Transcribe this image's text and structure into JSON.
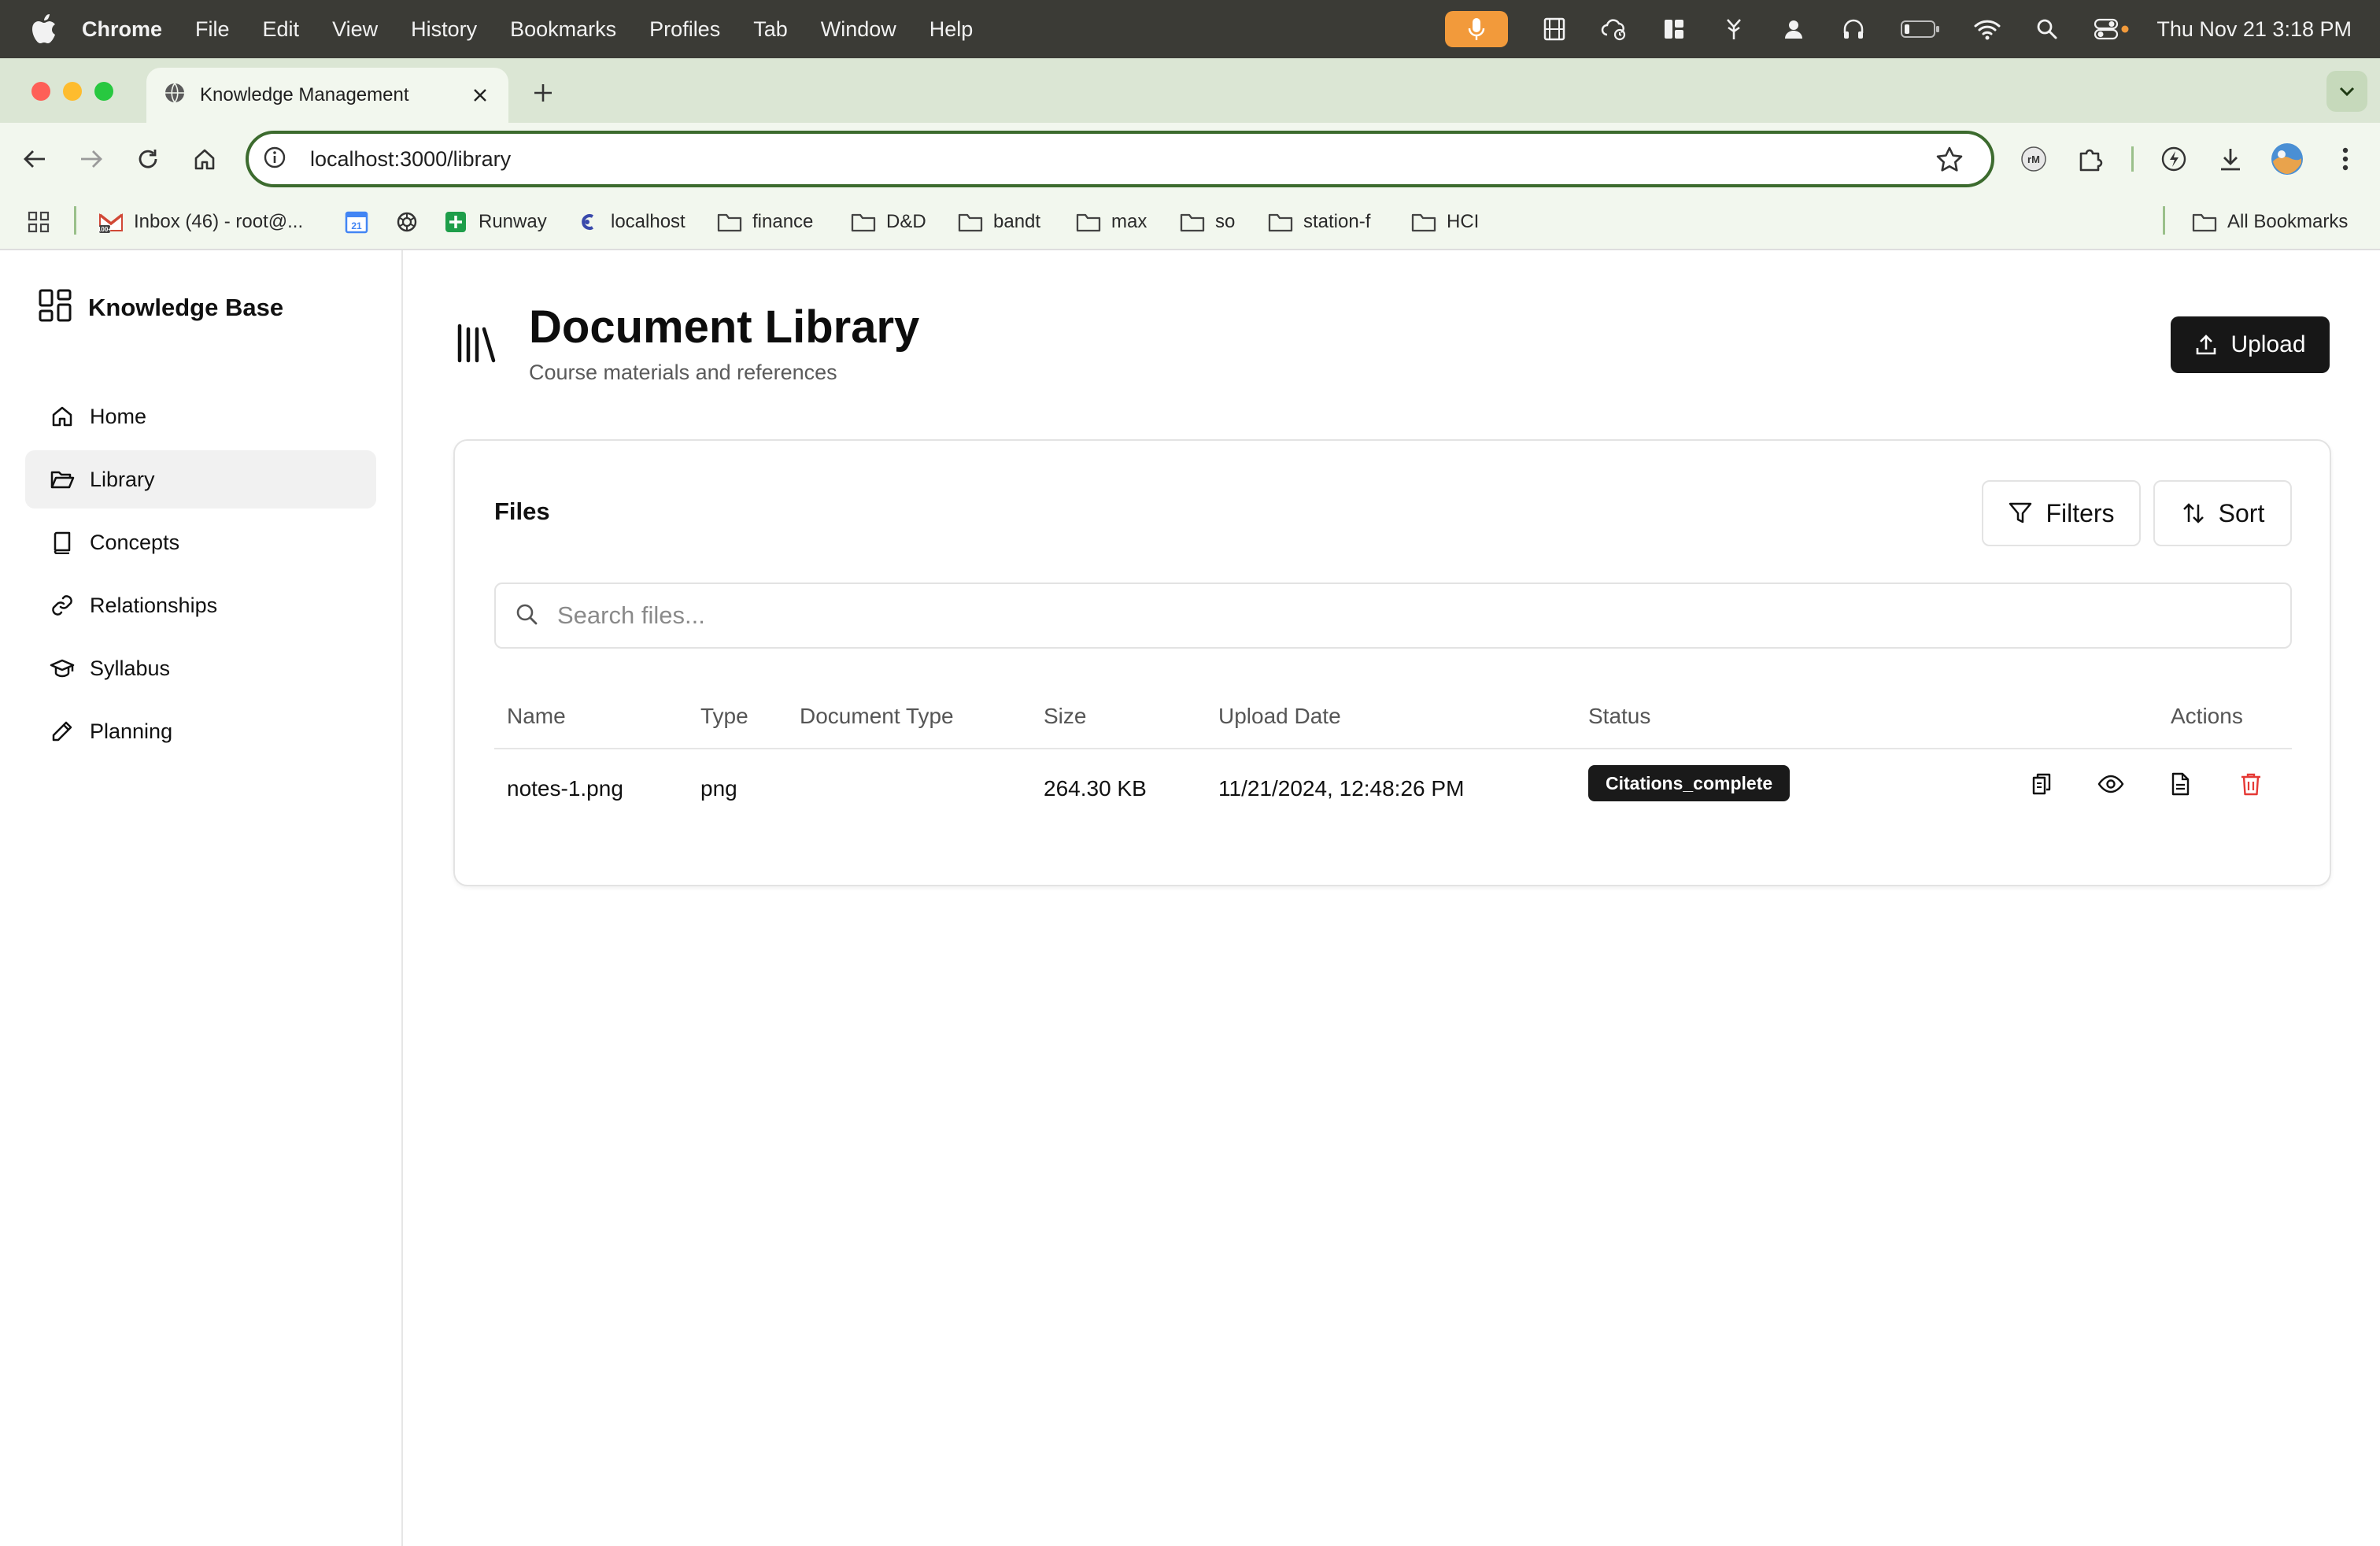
{
  "menubar": {
    "app_name": "Chrome",
    "menus": [
      "File",
      "Edit",
      "View",
      "History",
      "Bookmarks",
      "Profiles",
      "Tab",
      "Window",
      "Help"
    ],
    "clock": "Thu Nov 21  3:18 PM"
  },
  "browser": {
    "tab_title": "Knowledge Management",
    "url": "localhost:3000/library",
    "bookmarks": [
      {
        "label": "Inbox (46) - root@...",
        "icon": "gmail-icon"
      },
      {
        "label": "",
        "icon": "calendar-icon"
      },
      {
        "label": "",
        "icon": "openai-icon"
      },
      {
        "label": "Runway",
        "icon": "runway-icon"
      },
      {
        "label": "localhost",
        "icon": "localhost-icon"
      },
      {
        "label": "finance",
        "icon": "folder-icon"
      },
      {
        "label": "D&D",
        "icon": "folder-icon"
      },
      {
        "label": "bandt",
        "icon": "folder-icon"
      },
      {
        "label": "max",
        "icon": "folder-icon"
      },
      {
        "label": "so",
        "icon": "folder-icon"
      },
      {
        "label": "station-f",
        "icon": "folder-icon"
      },
      {
        "label": "HCI",
        "icon": "folder-icon"
      }
    ],
    "all_bookmarks": "All Bookmarks",
    "calendar_day": "21"
  },
  "sidebar": {
    "brand": "Knowledge Base",
    "items": [
      {
        "label": "Home",
        "icon": "home-icon",
        "active": false
      },
      {
        "label": "Library",
        "icon": "folder-open-icon",
        "active": true
      },
      {
        "label": "Concepts",
        "icon": "book-icon",
        "active": false
      },
      {
        "label": "Relationships",
        "icon": "link-icon",
        "active": false
      },
      {
        "label": "Syllabus",
        "icon": "graduation-cap-icon",
        "active": false
      },
      {
        "label": "Planning",
        "icon": "pencil-icon",
        "active": false
      }
    ]
  },
  "page": {
    "title": "Document Library",
    "subtitle": "Course materials and references",
    "upload_label": "Upload"
  },
  "files": {
    "title": "Files",
    "filters_label": "Filters",
    "sort_label": "Sort",
    "search_placeholder": "Search files...",
    "columns": [
      "Name",
      "Type",
      "Document Type",
      "Size",
      "Upload Date",
      "Status",
      "Actions"
    ],
    "rows": [
      {
        "name": "notes-1.png",
        "type": "png",
        "document_type": "",
        "size": "264.30 KB",
        "upload_date": "11/21/2024, 12:48:26 PM",
        "status": "Citations_complete"
      }
    ]
  },
  "colors": {
    "accent_dark": "#171717",
    "delete_red": "#e53935",
    "chrome_frame": "#dbe6d4",
    "omnibox_border": "#3c6b2e",
    "mic_orange": "#f29a3b"
  }
}
